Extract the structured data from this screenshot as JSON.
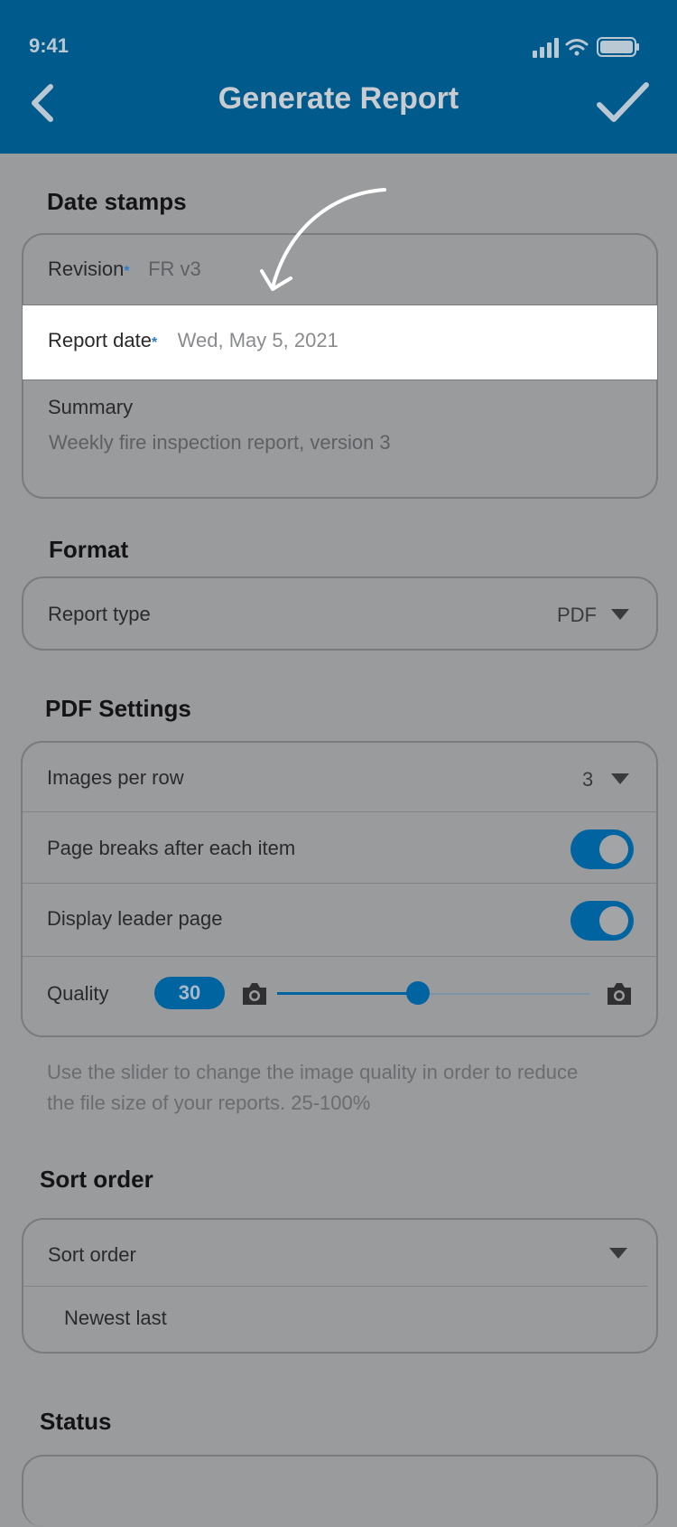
{
  "status_bar": {
    "time": "9:41"
  },
  "header": {
    "title": "Generate Report"
  },
  "date_stamps": {
    "section_title": "Date stamps",
    "revision_label": "Revision",
    "revision_required": "*",
    "revision_value": "FR v3",
    "report_date_label": "Report date",
    "report_date_required": "*",
    "report_date_value": "Wed, May 5, 2021",
    "summary_label": "Summary",
    "summary_value": "Weekly fire inspection report, version 3"
  },
  "format": {
    "section_title": "Format",
    "report_type_label": "Report type",
    "report_type_value": "PDF"
  },
  "pdf_settings": {
    "section_title": "PDF Settings",
    "images_per_row_label": "Images per row",
    "images_per_row_value": "3",
    "page_breaks_label": "Page breaks after each item",
    "page_breaks_on": true,
    "leader_page_label": "Display leader page",
    "leader_page_on": true,
    "quality_label": "Quality",
    "quality_value": "30",
    "quality_fraction": 0.45,
    "helper_line1": "Use the slider to change the image quality in order to reduce",
    "helper_line2": "the file size of your reports. 25-100%"
  },
  "sort_order": {
    "section_title": "Sort order",
    "label": "Sort order",
    "selected": "Newest last"
  },
  "status": {
    "section_title": "Status"
  },
  "colors": {
    "header_bg": "#005a8c",
    "accent": "#0064a0",
    "overlay_bg": "#9a9b9d",
    "required": "#2c7bd1"
  },
  "icons": [
    "back-chevron-icon",
    "checkmark-icon",
    "signal-icon",
    "wifi-icon",
    "battery-icon",
    "camera-icon",
    "caret-down-icon"
  ]
}
